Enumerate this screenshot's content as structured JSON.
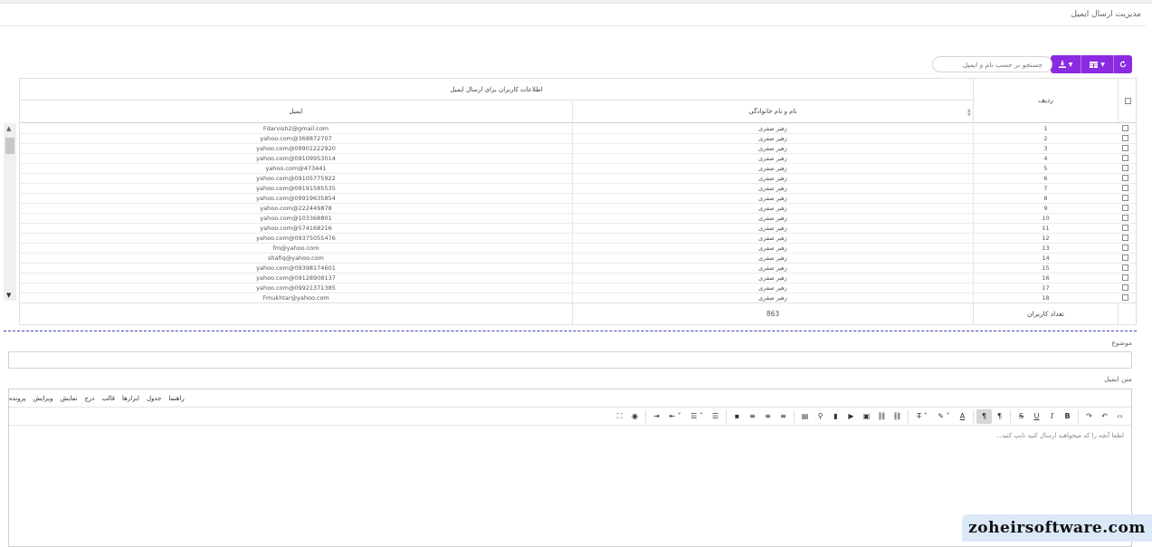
{
  "page": {
    "title": "مدیریت ارسال ایمیل"
  },
  "toolbar": {
    "search_placeholder": "جستجو بر حسب نام و ایمیل",
    "refresh_icon": "refresh-icon",
    "columns_icon": "columns-icon",
    "download_icon": "download-icon",
    "accent": "#8a2be2"
  },
  "table": {
    "group_header": "اطلاعات کاربران برای ارسال ایمیل",
    "col_radif": "ردیف",
    "col_name": "نام و نام خانوادگی",
    "col_email": "ایمیل",
    "rows": [
      {
        "n": "1",
        "name": "زهیر صفری",
        "email": "Fdarvish2@gmail.com"
      },
      {
        "n": "2",
        "name": "زهیر صفری",
        "email": "yahoo.com@368872707"
      },
      {
        "n": "3",
        "name": "زهیر صفری",
        "email": "yahoo.com@09901222920"
      },
      {
        "n": "4",
        "name": "زهیر صفری",
        "email": "yahoo.com@09109953014"
      },
      {
        "n": "5",
        "name": "زهیر صفری",
        "email": "yahoo.com@473441"
      },
      {
        "n": "6",
        "name": "زهیر صفری",
        "email": "yahoo.com@09105775922"
      },
      {
        "n": "7",
        "name": "زهیر صفری",
        "email": "yahoo.com@09191585535"
      },
      {
        "n": "8",
        "name": "زهیر صفری",
        "email": "yahoo.com@09919635854"
      },
      {
        "n": "9",
        "name": "زهیر صفری",
        "email": "yahoo.com@222449878"
      },
      {
        "n": "10",
        "name": "زهیر صفری",
        "email": "yahoo.com@103368801"
      },
      {
        "n": "11",
        "name": "زهیر صفری",
        "email": "yahoo.com@574168216"
      },
      {
        "n": "12",
        "name": "زهیر صفری",
        "email": "yahoo.com@09375055476"
      },
      {
        "n": "13",
        "name": "زهیر صفری",
        "email": "fm@yahoo.com"
      },
      {
        "n": "14",
        "name": "زهیر صفری",
        "email": "shafiq@yahoo.com"
      },
      {
        "n": "15",
        "name": "زهیر صفری",
        "email": "yahoo.com@09398174601"
      },
      {
        "n": "16",
        "name": "زهیر صفری",
        "email": "yahoo.com@09128908137"
      },
      {
        "n": "17",
        "name": "زهیر صفری",
        "email": "yahoo.com@09921371385"
      },
      {
        "n": "18",
        "name": "زهیر صفری",
        "email": "Fmukhtar@yahoo.com"
      }
    ],
    "footer_label": "تعداد کاربران",
    "footer_count": "863"
  },
  "form": {
    "subject_label": "موضوع",
    "body_label": "متن ایمیل"
  },
  "editor": {
    "menus": [
      "پرونده",
      "ویرایش",
      "نمایش",
      "درج",
      "قالب",
      "ابزارها",
      "جدول",
      "راهنما"
    ],
    "placeholder": "لطفا آنچه را که میخواهید ارسال کنید تایپ کنید..."
  },
  "watermark": "zoheirsoftware.com"
}
